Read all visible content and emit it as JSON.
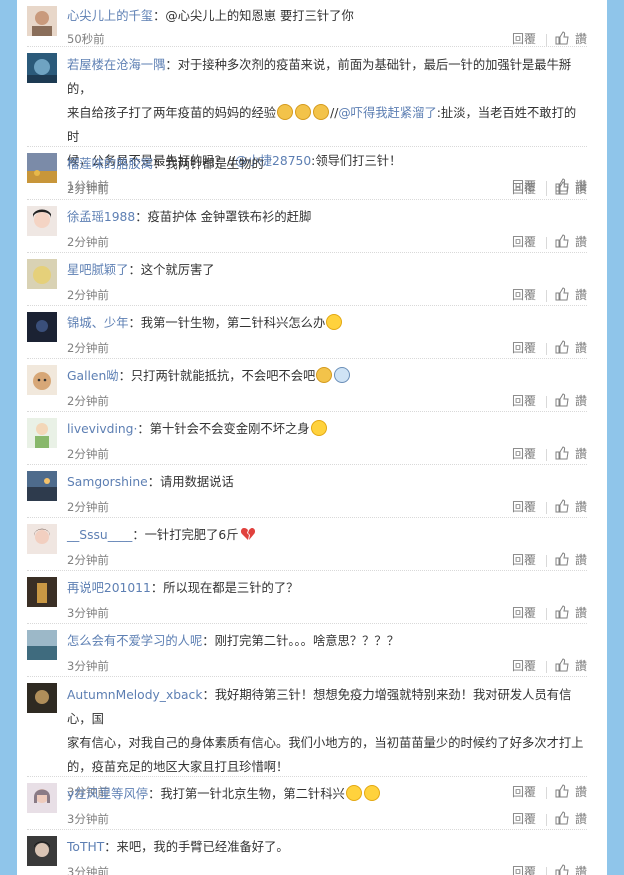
{
  "actions": {
    "reply": "回覆",
    "report": "讚"
  },
  "comments": [
    {
      "user": "心尖儿上的千玺",
      "text": "：@心尖儿上的知恩崽 要打三针了你",
      "time": "50秒前"
    },
    {
      "user": "若屋楼在沧海一隅",
      "text_l1": "：对于接种多次剂的疫苗来说，前面为基础针，最后一针的加强针是最牛掰的，",
      "text_l2": "来自给孩子打了两年疫苗的妈妈的经验",
      "l2_after": "//",
      "mention1": "@吓得我赶紧溜了",
      "l2_tail": ":扯淡，当老百姓不敢打的时",
      "text_l3": "候，公务员不是最先打的吗？//",
      "mention2": "@小捷28750",
      "l3_tail": ":领导们打三针！",
      "time": "1分钟前"
    },
    {
      "user": "榴莲味的胳胶窝",
      "text": "：我两针都是生物的",
      "time": "2分钟前"
    },
    {
      "user": "徐孟瑶1988",
      "text": "：疫苗护体 金钟罩铁布衫的赶脚",
      "time": "2分钟前"
    },
    {
      "user": "星吧腻颖了",
      "text": "：这个就厉害了",
      "time": "2分钟前"
    },
    {
      "user": "锦城、少年",
      "text": "：我第一针生物，第二针科兴怎么办",
      "time": "2分钟前"
    },
    {
      "user": "Gallen呦",
      "text": "：只打两针就能抵抗，不会吧不会吧",
      "time": "2分钟前"
    },
    {
      "user": "livevivding·",
      "text": "：第十针会不会变金刚不坏之身",
      "time": "2分钟前"
    },
    {
      "user": "Samgorshine",
      "text": "：请用数据说话",
      "time": "2分钟前"
    },
    {
      "user": "__Sssu____",
      "text": "：一针打完肥了6斤",
      "time": "2分钟前"
    },
    {
      "user": "再说吧201011",
      "text": "：所以现在都是三针的了？",
      "time": "3分钟前"
    },
    {
      "user": "怎么会有不爱学习的人呢",
      "text": "：刚打完第二针。。。啥意思？？？？",
      "time": "3分钟前"
    },
    {
      "user": "AutumnMelody_xback",
      "text_l1": "：我好期待第三针！想想免疫力增强就特别来劲！我对研发人员有信心，国",
      "text_l2": "家有信心，对我自己的身体素质有信心。我们小地方的，当初苗苗量少的时候约了好多次才打上",
      "text_l3": "的，疫苗充足的地区大家且打且珍惜啊！",
      "time": "3分钟前"
    },
    {
      "user": "y在风里等风停",
      "text": "：我打第一针北京生物，第二针科兴",
      "time": "3分钟前"
    },
    {
      "user": "ToTHT",
      "text": "：来吧，我的手臂已经准备好了。",
      "time": "3分钟前"
    }
  ],
  "colors": {
    "username": "#5d7fb3",
    "background": "#8fc5ea",
    "meta": "#808080"
  }
}
